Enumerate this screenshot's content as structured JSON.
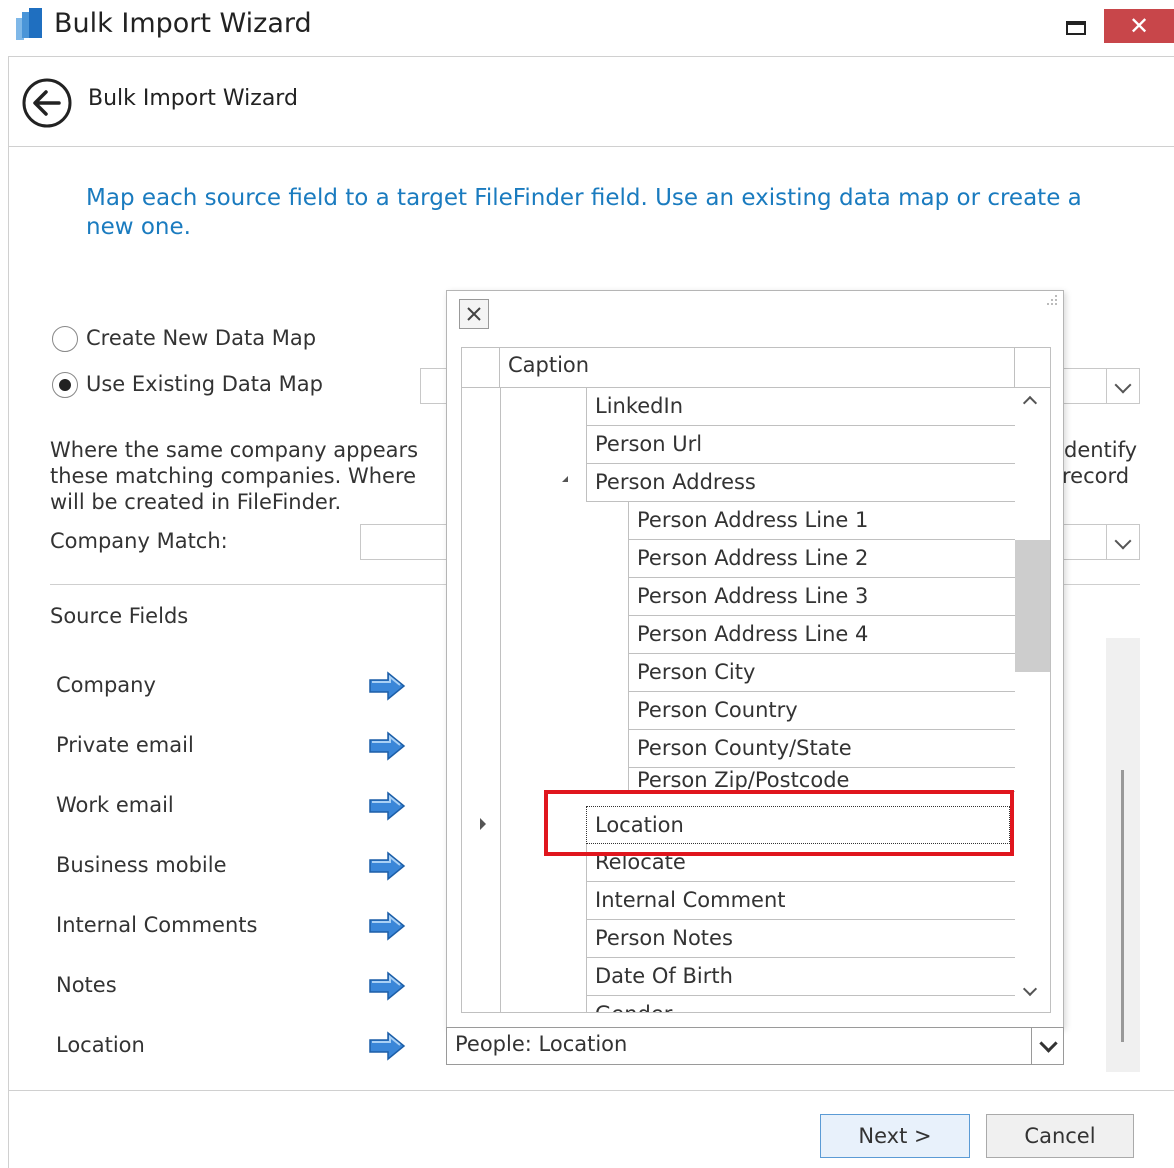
{
  "window": {
    "title": "Bulk Import Wizard",
    "close_glyph": "✕",
    "icon": "app-icon"
  },
  "header": {
    "title": "Bulk Import Wizard",
    "back_icon": "back-arrow-icon"
  },
  "instructions": "Map each source field to a target FileFinder field. Use an existing data map or create a new one.",
  "data_map_options": [
    {
      "label": "Create New Data Map",
      "checked": false
    },
    {
      "label": "Use Existing Data Map",
      "checked": true
    }
  ],
  "matching_text": {
    "line1_left": "Where the same company appears",
    "line1_right": "dentify",
    "line2_left": "these matching companies. Where",
    "line2_right": "record",
    "line3_left": "will be created in FileFinder."
  },
  "company_match_label": "Company Match:",
  "source_fields_title": "Source Fields",
  "source_fields": [
    "Company",
    "Private email",
    "Work email",
    "Business mobile",
    "Internal Comments",
    "Notes",
    "Location"
  ],
  "popup": {
    "caption_header": "Caption",
    "rows": [
      {
        "label": "LinkedIn",
        "level": 1
      },
      {
        "label": "Person Url",
        "level": 1
      },
      {
        "label": "Person Address",
        "level": 1
      },
      {
        "label": "Person Address Line 1",
        "level": 2
      },
      {
        "label": "Person Address Line 2",
        "level": 2
      },
      {
        "label": "Person Address Line 3",
        "level": 2
      },
      {
        "label": "Person Address Line 4",
        "level": 2
      },
      {
        "label": "Person City",
        "level": 2
      },
      {
        "label": "Person Country",
        "level": 2
      },
      {
        "label": "Person County/State",
        "level": 2
      },
      {
        "label": "Person Zip/Postcode",
        "level": 2
      },
      {
        "label": "Location",
        "level": 1
      },
      {
        "label": "Relocate",
        "level": 1
      },
      {
        "label": "Internal Comment",
        "level": 1
      },
      {
        "label": "Person Notes",
        "level": 1
      },
      {
        "label": "Date Of Birth",
        "level": 1
      },
      {
        "label": "Gender",
        "level": 1
      }
    ]
  },
  "selected_target": "People: Location",
  "buttons": {
    "next": "Next >",
    "cancel": "Cancel"
  },
  "colors": {
    "accent_text": "#1a7bbf",
    "close_button": "#c8464a",
    "highlight": "#e0161e",
    "arrow_icon": "#3a86d8"
  }
}
